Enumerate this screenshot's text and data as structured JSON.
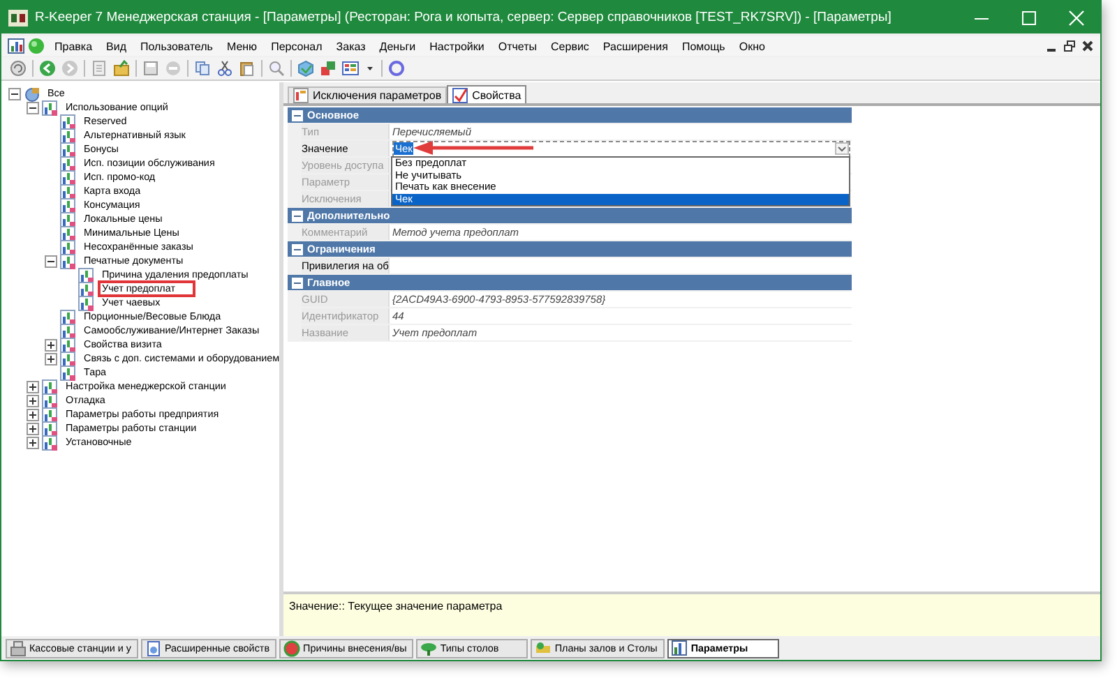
{
  "window": {
    "title": "R-Keeper 7 Менеджерская станция - [Параметры] (Ресторан: Рога и копыта, сервер: Сервер справочников [TEST_RK7SRV]) - [Параметры]"
  },
  "menu": [
    "Правка",
    "Вид",
    "Пользователь",
    "Меню",
    "Персонал",
    "Заказ",
    "Деньги",
    "Настройки",
    "Отчеты",
    "Сервис",
    "Расширения",
    "Помощь",
    "Окно"
  ],
  "tree": [
    {
      "label": "Все",
      "kind": "root",
      "expanded": true,
      "marked": false,
      "children": [
        {
          "label": "Использование опций",
          "kind": "group",
          "expanded": true,
          "marked": false,
          "children": [
            {
              "label": "Reserved",
              "kind": "leaf",
              "marked": false
            },
            {
              "label": "Альтернативный язык",
              "kind": "leaf",
              "marked": false
            },
            {
              "label": "Бонусы",
              "kind": "leaf",
              "marked": false
            },
            {
              "label": "Исп. позиции обслуживания",
              "kind": "leaf",
              "marked": false
            },
            {
              "label": "Исп. промо-код",
              "kind": "leaf",
              "marked": false
            },
            {
              "label": "Карта входа",
              "kind": "leaf",
              "marked": false
            },
            {
              "label": "Консумация",
              "kind": "leaf",
              "marked": false
            },
            {
              "label": "Локальные цены",
              "kind": "leaf",
              "marked": false
            },
            {
              "label": "Минимальные Цены",
              "kind": "leaf",
              "marked": false
            },
            {
              "label": "Несохранённые заказы",
              "kind": "leaf",
              "marked": false
            },
            {
              "label": "Печатные документы",
              "kind": "group",
              "expanded": true,
              "marked": false,
              "children": [
                {
                  "label": "Причина удаления предоплаты",
                  "kind": "leaf",
                  "marked": false
                },
                {
                  "label": "Учет предоплат",
                  "kind": "leaf",
                  "marked": true
                },
                {
                  "label": "Учет чаевых",
                  "kind": "leaf",
                  "marked": false
                }
              ]
            },
            {
              "label": "Порционные/Весовые Блюда",
              "kind": "leaf",
              "marked": false
            },
            {
              "label": "Самообслуживание/Интернет Заказы",
              "kind": "leaf",
              "marked": false
            },
            {
              "label": "Свойства визита",
              "kind": "group",
              "expanded": false,
              "marked": false
            },
            {
              "label": "Связь с доп. системами и оборудованием",
              "kind": "group",
              "expanded": false,
              "marked": false
            },
            {
              "label": "Тара",
              "kind": "leaf",
              "marked": false
            }
          ]
        },
        {
          "label": "Настройка менеджерской станции",
          "kind": "group",
          "expanded": false,
          "marked": false
        },
        {
          "label": "Отладка",
          "kind": "group",
          "expanded": false,
          "marked": false
        },
        {
          "label": "Параметры работы предприятия",
          "kind": "group",
          "expanded": false,
          "marked": false
        },
        {
          "label": "Параметры работы станции",
          "kind": "group",
          "expanded": false,
          "marked": false
        },
        {
          "label": "Установочные",
          "kind": "group",
          "expanded": false,
          "marked": false
        }
      ]
    }
  ],
  "tabs": [
    {
      "label": "Исключения параметров",
      "selected": false
    },
    {
      "label": "Свойства",
      "selected": true
    }
  ],
  "sections": [
    {
      "title": "Основное",
      "expanded": true,
      "rows": [
        {
          "label": "Тип",
          "kind": "text",
          "disabled": true,
          "value": "Перечисляемый",
          "annotated": false
        },
        {
          "label": "Значение",
          "kind": "combo",
          "disabled": false,
          "value": "Чек",
          "annotated": true,
          "options": [
            {
              "label": "Без предоплат",
              "selected": false
            },
            {
              "label": "Не учитывать",
              "selected": false
            },
            {
              "label": "Печать как внесение",
              "selected": false
            },
            {
              "label": "Чек",
              "selected": true
            }
          ]
        },
        {
          "label": "Уровень доступа",
          "kind": "text",
          "disabled": true,
          "annotated": false
        },
        {
          "label": "Параметр",
          "kind": "text",
          "disabled": true,
          "annotated": false
        },
        {
          "label": "Исключения",
          "kind": "text",
          "disabled": true,
          "annotated": false
        }
      ]
    },
    {
      "title": "Дополнительно",
      "expanded": true,
      "rows": [
        {
          "label": "Комментарий",
          "kind": "text",
          "disabled": true,
          "value": "Метод учета предоплат",
          "annotated": false
        }
      ]
    },
    {
      "title": "Ограничения",
      "expanded": true,
      "rows": [
        {
          "label": "Привилегия на об",
          "kind": "text",
          "disabled": false,
          "annotated": false
        }
      ]
    },
    {
      "title": "Главное",
      "expanded": true,
      "rows": [
        {
          "label": "GUID",
          "kind": "text",
          "disabled": true,
          "value": "{2ACD49A3-6900-4793-8953-577592839758}",
          "annotated": false
        },
        {
          "label": "Идентификатор",
          "kind": "text",
          "disabled": true,
          "value": "44",
          "annotated": false
        },
        {
          "label": "Название",
          "kind": "text",
          "disabled": true,
          "value": "Учет предоплат",
          "annotated": false
        }
      ]
    }
  ],
  "description": "Значение:: Текущее значение параметра",
  "bottom_tabs": [
    {
      "label": "Кассовые станции и у",
      "selected": false
    },
    {
      "label": "Расширенные свойств",
      "selected": false
    },
    {
      "label": "Причины внесения/вы",
      "selected": false
    },
    {
      "label": "Типы столов",
      "selected": false
    },
    {
      "label": "Планы залов и Столы",
      "selected": false
    },
    {
      "label": "Параметры",
      "selected": true
    }
  ]
}
